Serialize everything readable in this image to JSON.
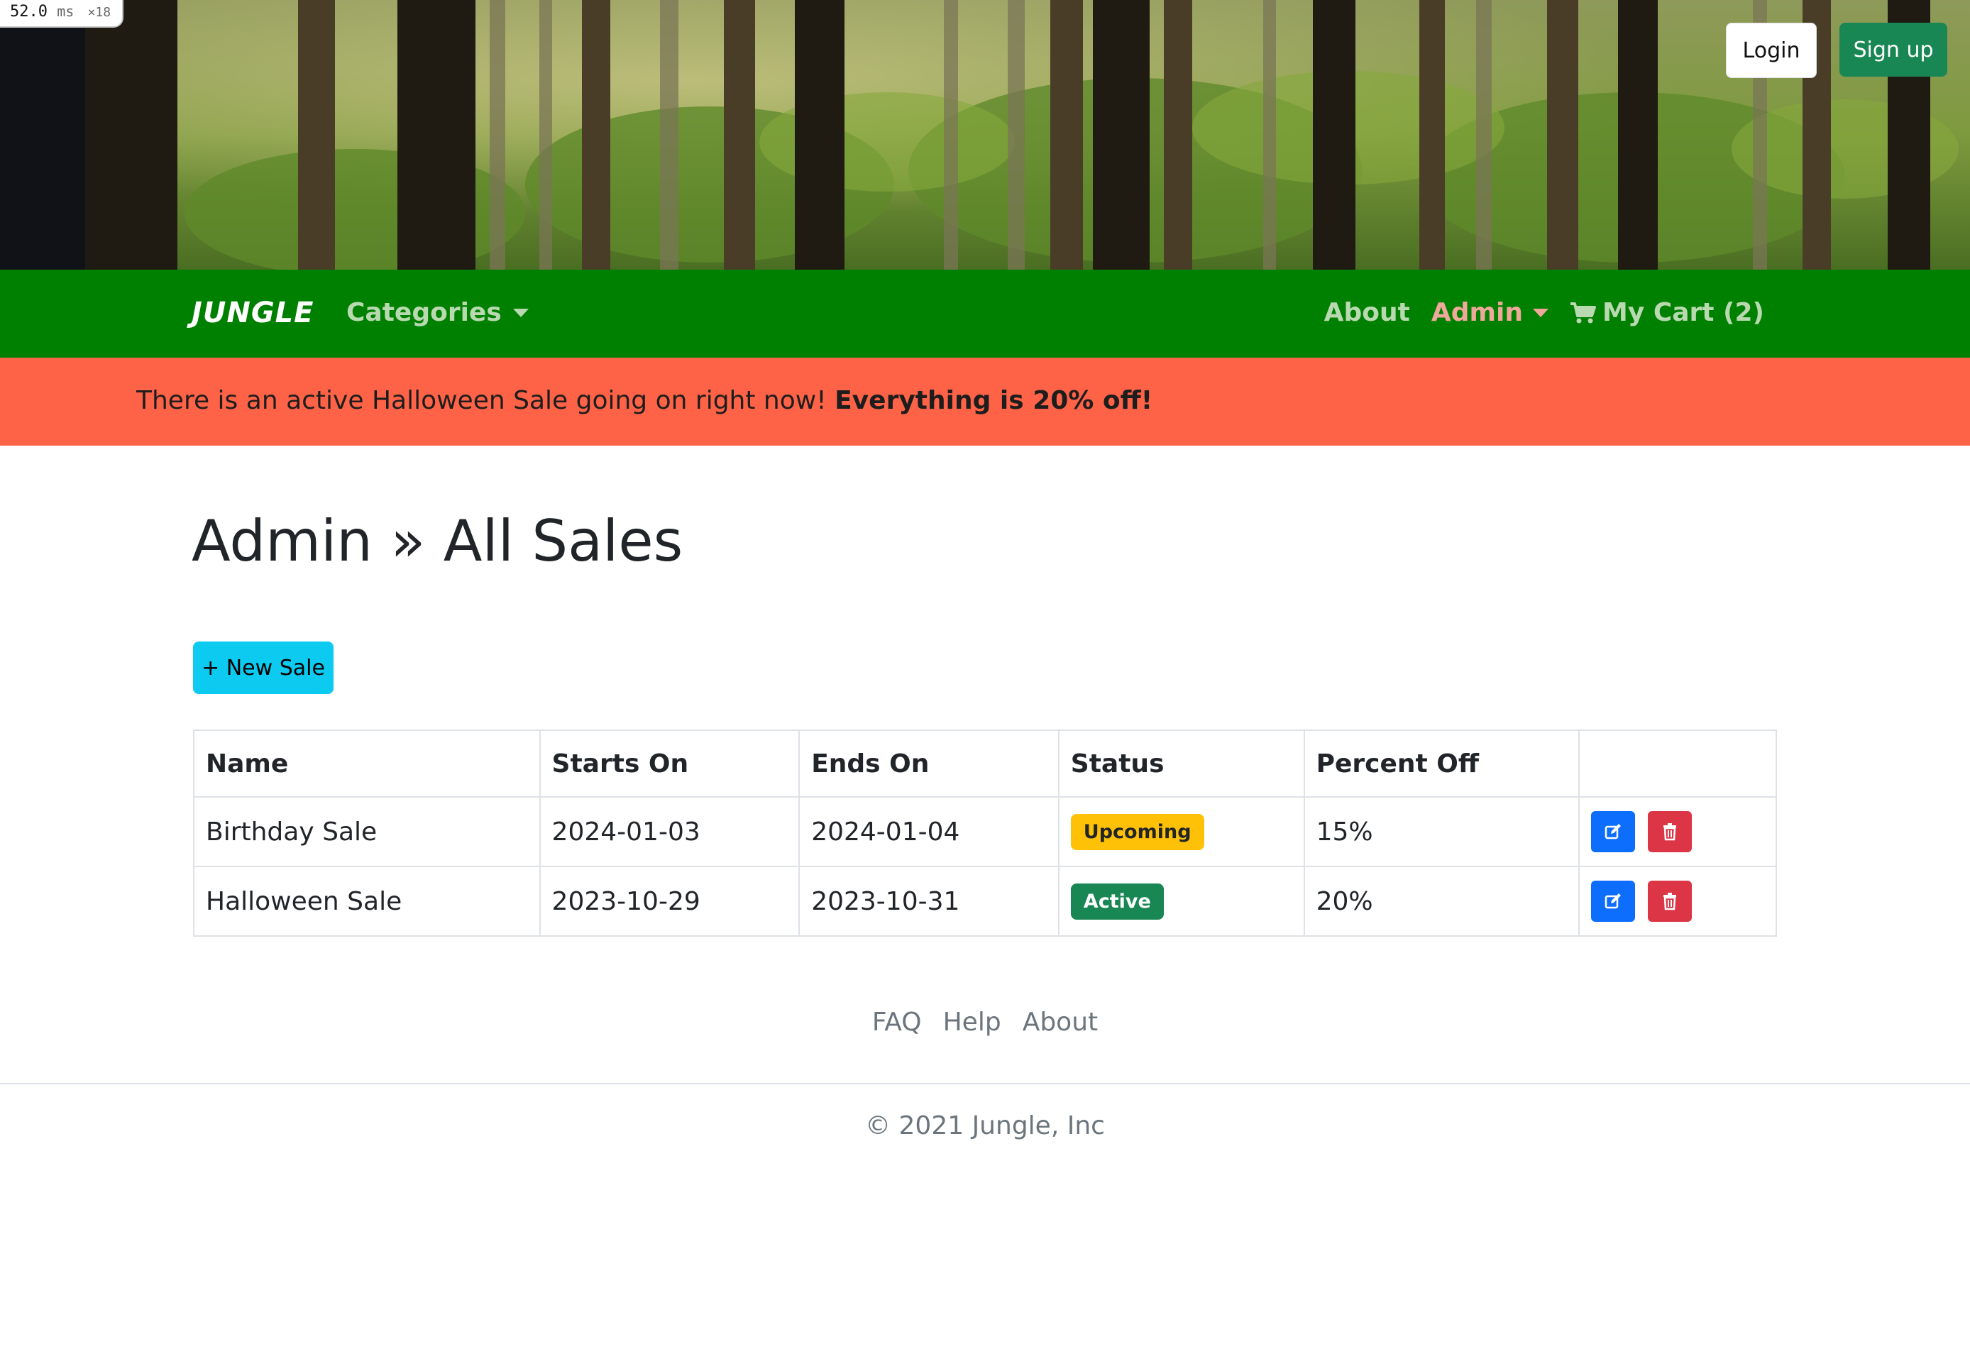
{
  "perf": {
    "value": "52.0",
    "unit": "ms",
    "multiplier": "×18"
  },
  "header": {
    "login_label": "Login",
    "signup_label": "Sign up"
  },
  "navbar": {
    "brand": "JUNGLE",
    "categories_label": "Categories",
    "about_label": "About",
    "admin_label": "Admin",
    "cart_label": "My Cart (2)",
    "bg_color": "#008000"
  },
  "banner": {
    "text": "There is an active Halloween Sale going on right now!",
    "emphasis": "Everything is 20% off!",
    "bg_color": "#ff6347"
  },
  "main": {
    "title": "Admin » All Sales",
    "new_sale_label": "+ New Sale",
    "table": {
      "headers": [
        "Name",
        "Starts On",
        "Ends On",
        "Status",
        "Percent Off",
        ""
      ],
      "rows": [
        {
          "name": "Birthday Sale",
          "starts_on": "2024-01-03",
          "ends_on": "2024-01-04",
          "status": "Upcoming",
          "percent_off": "15%"
        },
        {
          "name": "Halloween Sale",
          "starts_on": "2023-10-29",
          "ends_on": "2023-10-31",
          "status": "Active",
          "percent_off": "20%"
        }
      ],
      "row_actions": [
        "edit-icon",
        "trash-icon"
      ]
    }
  },
  "footer": {
    "links": [
      "FAQ",
      "Help",
      "About"
    ],
    "copyright": "© 2021 Jungle, Inc"
  }
}
